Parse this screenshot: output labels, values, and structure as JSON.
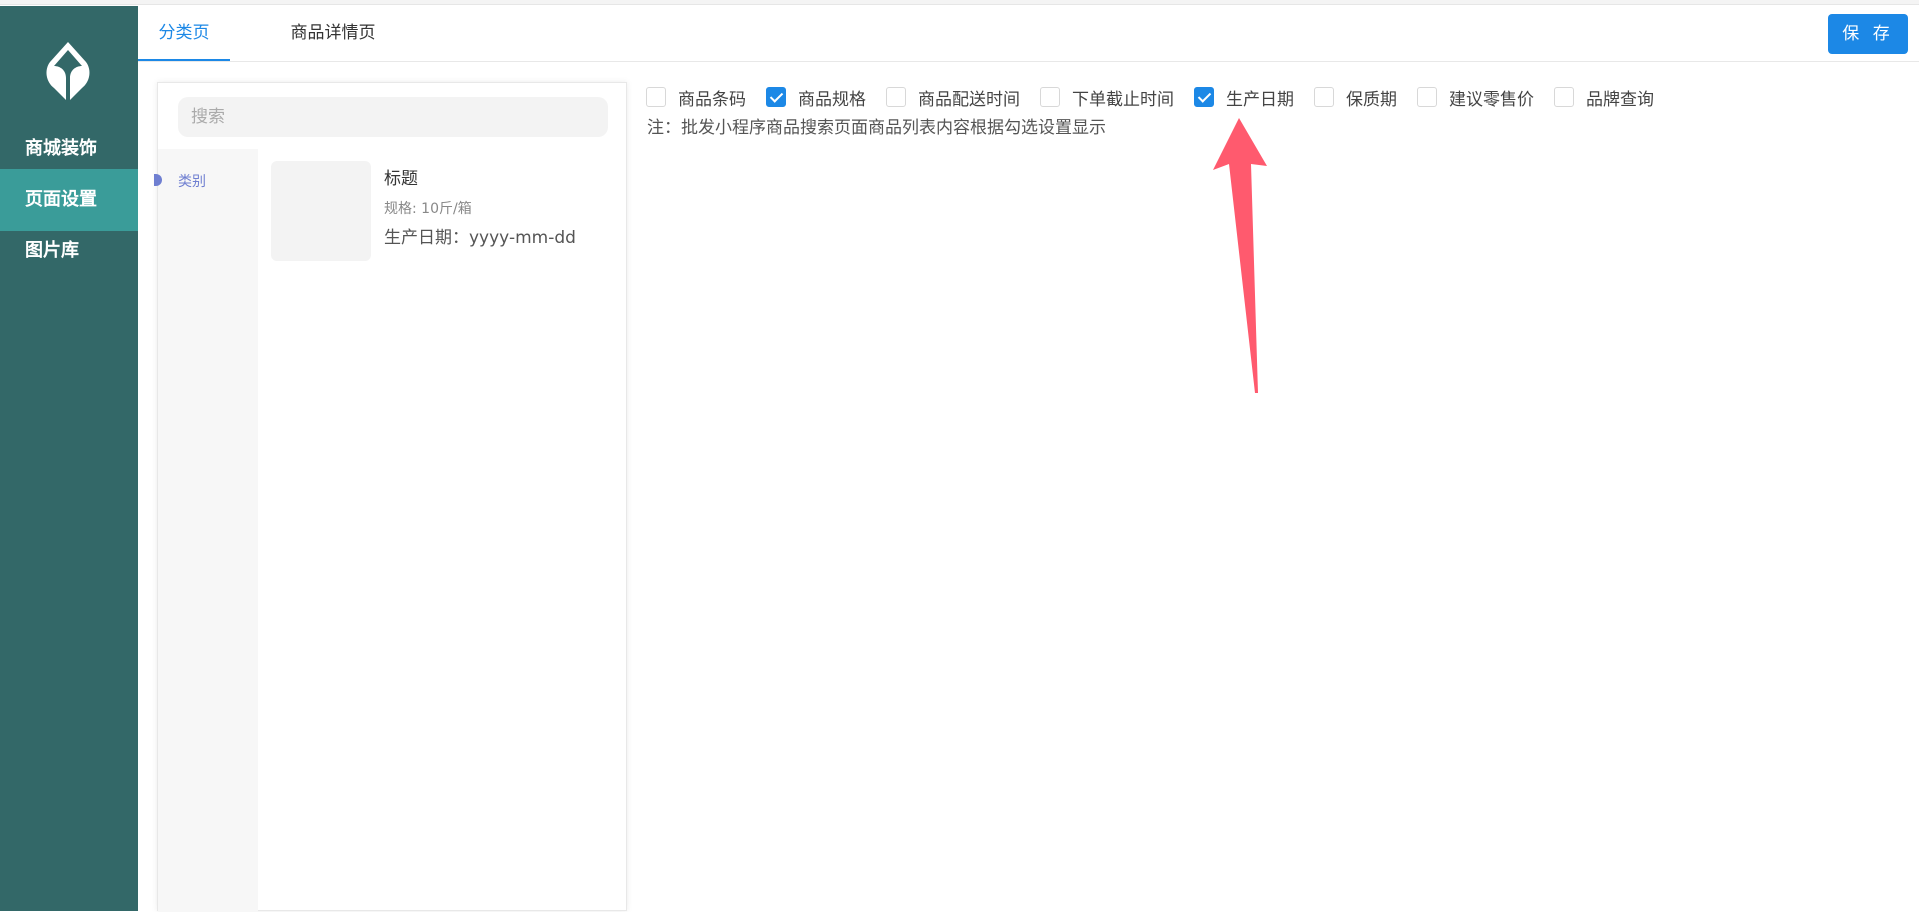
{
  "sidebar": {
    "logo": "leaf-logo",
    "items": [
      {
        "label": "商城装饰",
        "active": false
      },
      {
        "label": "页面设置",
        "active": true
      },
      {
        "label": "图片库",
        "active": false
      }
    ]
  },
  "header": {
    "tabs": [
      {
        "label": "分类页",
        "active": true
      },
      {
        "label": "商品详情页",
        "active": false
      }
    ],
    "save_label": "保 存"
  },
  "preview": {
    "search_placeholder": "搜索",
    "category_label": "类别",
    "product": {
      "title": "标题",
      "spec": "规格: 10斤/箱",
      "date": "生产日期：yyyy-mm-dd"
    }
  },
  "options": [
    {
      "label": "商品条码",
      "checked": false
    },
    {
      "label": "商品规格",
      "checked": true
    },
    {
      "label": "商品配送时间",
      "checked": false
    },
    {
      "label": "下单截止时间",
      "checked": false
    },
    {
      "label": "生产日期",
      "checked": true
    },
    {
      "label": "保质期",
      "checked": false
    },
    {
      "label": "建议零售价",
      "checked": false
    },
    {
      "label": "品牌查询",
      "checked": false
    }
  ],
  "note": "注：批发小程序商品搜索页面商品列表内容根据勾选设置显示",
  "colors": {
    "sidebar_bg": "#336868",
    "sidebar_active": "#3a9c99",
    "accent": "#1c88e6",
    "arrow": "#ff5a6e"
  }
}
